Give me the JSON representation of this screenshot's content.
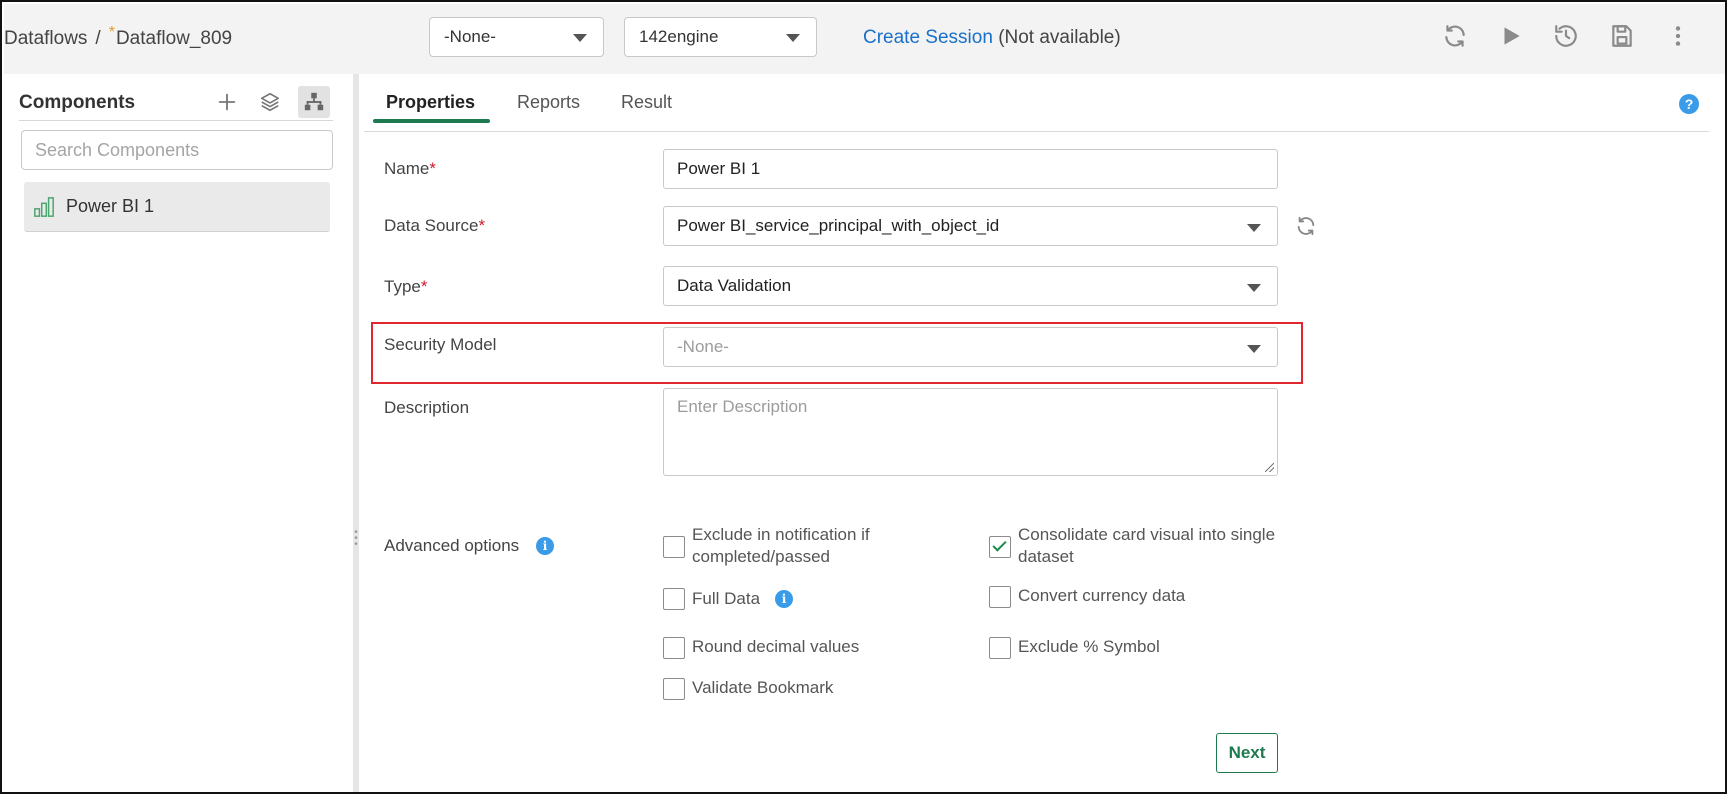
{
  "breadcrumb": {
    "root": "Dataflows",
    "separator": "/",
    "modified_marker": "*",
    "current": "Dataflow_809"
  },
  "toolbar": {
    "environment_select": "-None-",
    "engine_select": "142engine",
    "create_session_link": "Create Session",
    "session_status": "(Not available)",
    "icons": [
      "refresh-icon",
      "play-icon",
      "history-icon",
      "save-icon",
      "more-vertical-icon"
    ]
  },
  "components_panel": {
    "title": "Components",
    "search_placeholder": "Search Components",
    "items": [
      {
        "label": "Power BI 1",
        "icon": "chart-component-icon"
      }
    ]
  },
  "tabs": [
    {
      "label": "Properties",
      "active": true
    },
    {
      "label": "Reports",
      "active": false
    },
    {
      "label": "Result",
      "active": false
    }
  ],
  "help_icon": "?",
  "form": {
    "name": {
      "label": "Name",
      "required_mark": "*",
      "value": "Power BI 1"
    },
    "data_source": {
      "label": "Data Source",
      "required_mark": "*",
      "value": "Power BI_service_principal_with_object_id"
    },
    "type": {
      "label": "Type",
      "required_mark": "*",
      "value": "Data Validation"
    },
    "security_model": {
      "label": "Security Model",
      "value": "-None-"
    },
    "description": {
      "label": "Description",
      "placeholder": "Enter Description"
    },
    "advanced_options": {
      "label": "Advanced options",
      "info": "i",
      "checkboxes": [
        {
          "label": "Exclude in notification if completed/passed",
          "checked": false
        },
        {
          "label": "Consolidate card visual into single dataset",
          "checked": true
        },
        {
          "label": "Full Data",
          "checked": false
        },
        {
          "label": "Convert currency data",
          "checked": false
        },
        {
          "label": "Round decimal values",
          "checked": false
        },
        {
          "label": "Exclude % Symbol",
          "checked": false
        },
        {
          "label": "Validate Bookmark",
          "checked": false
        }
      ]
    },
    "next_button": "Next"
  },
  "colors": {
    "accent_green": "#1d7a4f",
    "link_blue": "#1a6fc9",
    "highlight_red": "#e0262e",
    "info_blue": "#3a9be8",
    "required_red": "#d0192f"
  }
}
